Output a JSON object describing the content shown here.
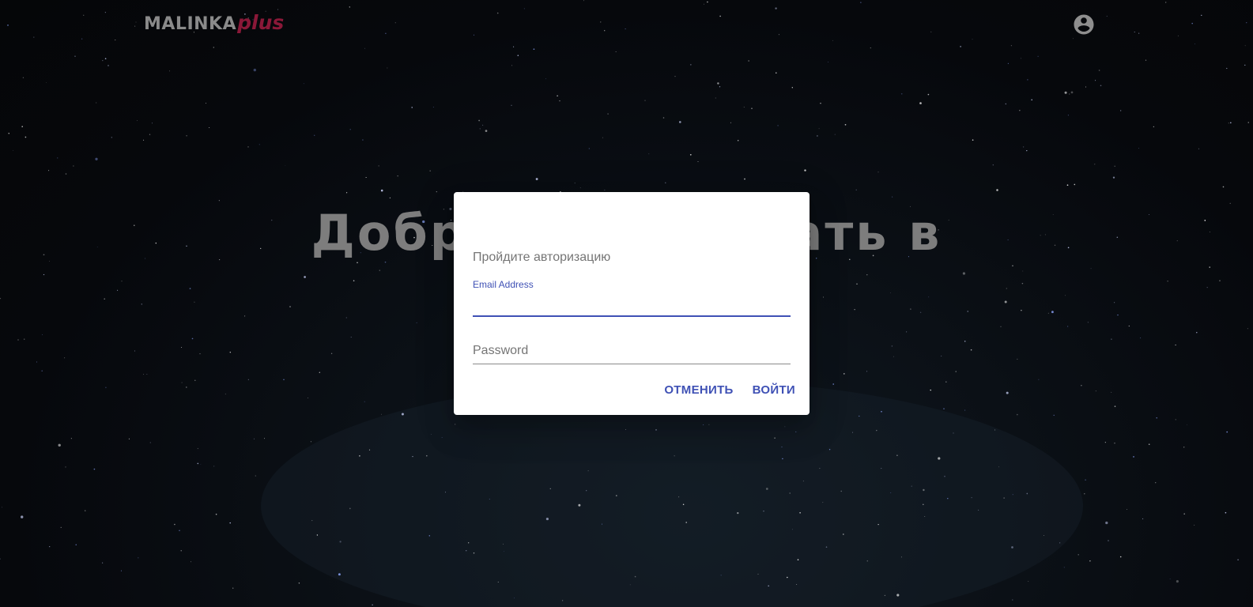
{
  "header": {
    "logo_main": "MALINKA",
    "logo_plus": "plus",
    "account_icon": "account-circle-icon"
  },
  "hero": {
    "title": "Добро пожаловать в"
  },
  "dialog": {
    "text": "Пройдите авторизацию",
    "email_label": "Email Address",
    "email_value": "",
    "password_placeholder": "Password",
    "password_value": "",
    "cancel_label": "ОТМЕНИТЬ",
    "submit_label": "ВОЙТИ"
  },
  "colors": {
    "accent": "#3f51b5",
    "brand": "#8a1838",
    "logo_gray": "#8a8a8a"
  }
}
